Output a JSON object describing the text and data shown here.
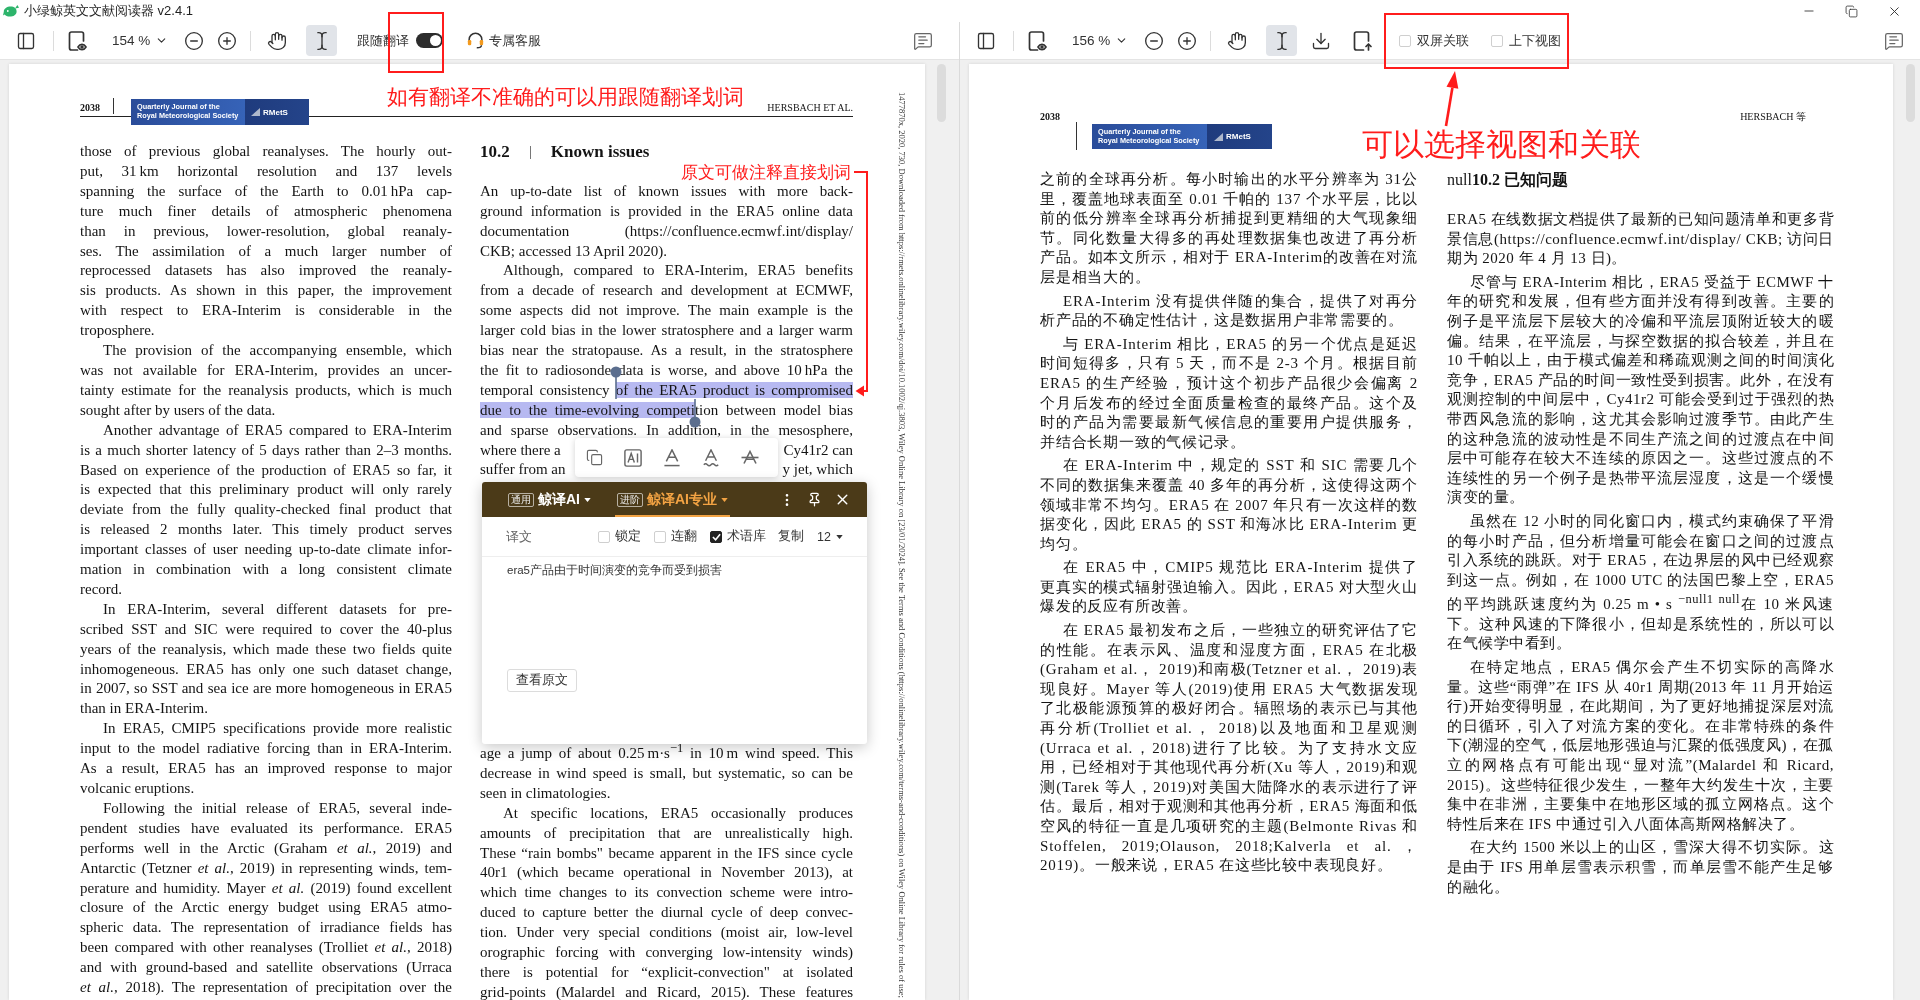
{
  "window": {
    "title": "小绿鲸英文文献阅读器 v2.4.1"
  },
  "left_pane": {
    "toolbar": {
      "zoom": "154 %",
      "tools": [
        {
          "kind": "hand",
          "selected": false
        },
        {
          "kind": "text",
          "selected": true
        }
      ],
      "follow_translation": {
        "label": "跟随翻译",
        "on": true
      },
      "support": "专属客服"
    },
    "page": {
      "page_number": "2038",
      "journal": "Quarterly Journal of the\nRoyal Meteorological Society",
      "publisher": "RMetS",
      "running_head": "HERSBACH ET AL.",
      "column_1": {
        "paragraphs": [
          {
            "text": "those of previous global reanalyses. The hourly out-\nput, 31 km horizontal resolution and 137 levels\nspanning the surface of the Earth to 0.01 hPa cap-\nture much finer details of atmospheric phenomena\nthan in previous, lower-resolution, global reanaly-\nses. The assimilation of a much larger number of\nreprocessed datasets has also improved the reanaly-\nsis products. As shown in this paper, the improvement\nwith respect to ERA-Interim is considerable in the\ntroposphere."
          },
          {
            "text": "The provision of the accompanying ensemble, which\nwas not available for ERA-Interim, provides an uncer-\ntainty estimate for the reanalysis products, which is much\nsought after by users of the data."
          },
          {
            "text": "Another advantage of ERA5 compared to ERA-Interim\nis a much shorter latency of 5 days rather than 2–3 months.\nBased on experience of the production of ERA5 so far, it\nis expected that this preliminary product will only rarely\ndeviate from the fully quality-checked final product that\nis released 2 months later. This timely product serves\nimportant classes of user needing up-to-date climate infor-\nmation in combination with a long consistent climate\nrecord."
          },
          {
            "text": "In ERA-Interim, several different datasets for pre-\nscribed SST and SIC were required to cover the 40-plus\nyears of the reanalysis, which made these two fields quite\ninhomogeneous. ERA5 has only one such dataset change,\nin 2007, so SST and sea ice are more homogeneous in ERA5\nthan in ERA-Interim."
          },
          {
            "text": "In ERA5, CMIP5 specifications provide more realistic\ninput to the model radiative forcing than in ERA-Interim.\nAs a result, ERA5 has an improved response to major\nvolcanic eruptions."
          },
          {
            "text": "Following the initial release of ERA5, several inde-\npendent studies have evaluated its performance. ERA5\nperforms well in the Arctic (Graham *et al.*, 2019) and\nAntarctic (Tetzner *et al.*, 2019) in representing winds, tem-\nperature and humidity. Mayer *et al.* (2019) found excellent\nclosure of the Arctic energy budget using ERA5 atmo-\nspheric data. The representation of irradiance fields has\nbeen compared with other reanalyses (Trolliet *et al.*, 2018)\nand with ground-based and satellite observations (Urraca\n*et al.*, 2018). The representation of precipitation over the"
          }
        ]
      },
      "column_2": {
        "section_number": "10.2",
        "section_title": "Known issues",
        "paragraphs": [
          {
            "text": "An up-to-date list of known issues with more back-\nground information is provided in the ERA5 online data\ndocumentation (https://confluence.ecmwf.int/display/\nCKB; accessed 13 April 2020)."
          },
          {
            "segments": [
              {
                "text": "Although, compared to ERA-Interim, ERA5 benefits\nfrom a decade of research and development at ECMWF,\nsome aspects did not improve. The main example is the\nlarger cold bias in the lower stratosphere and a larger warm\nbias near the stratopause. As a result, in the stratosphere\nthe fit to radiosonde data is worse, and above 10 hPa the",
                "selected": false
              },
              {
                "text": "temporal consistency ",
                "selected": false
              },
              {
                "text": "of the ERA5 product is compromised",
                "selected": true
              },
              {
                "text": "due to the time-evolving competi",
                "selected": true
              },
              {
                "text": "tion between model bias",
                "selected": false
              },
              {
                "text": "and sparse observations. In addition, in the mesosphere,",
                "selected": false
              }
            ]
          }
        ],
        "partly_hidden_lines": [
          {
            "start": "where there a",
            "end": "Cy41r2 can"
          },
          {
            "start": "suffer from an",
            "end": "y jet, which"
          }
        ],
        "paragraphs_below_popup": [
          {
            "text": "age a jump of about 0.25 m·s$^{−1}$ in 10 m wind speed. This\ndecrease in wind speed is small, but systematic, so can be\nseen in climatologies."
          },
          {
            "text": "At specific locations, ERA5 occasionally produces\namounts of precipitation that are unrealistically high.\nThese “rain bombs\" became apparent in the IFS since cycle\n40r1 (which became operational in November 2013), at\nwhich time changes to its convection scheme were intro-\nduced to capture better the diurnal cycle of deep convec-\ntion. Under very special conditions (moist air, low-level\norographic forcing with converging low-intensity winds)\nthere is potential for “explicit-convection\" at isolated\ngrid-points (Malardel and Ricard, 2015). These features"
          }
        ]
      },
      "margin_note": "1477870x, 2020, 730, Downloaded from https://rmets.onlinelibrary.wiley.com/doi/10.1002/qj.3803, Wiley Online Library on [23/01/2024]. See the Terms and Conditions (https://onlinelibrary.wiley.com/terms-and-conditions) on Wiley Online Library for rules of use;"
    }
  },
  "right_pane": {
    "toolbar": {
      "zoom": "156 %",
      "tools": [
        {
          "kind": "hand",
          "selected": false
        },
        {
          "kind": "text",
          "selected": true
        }
      ],
      "view_options": [
        {
          "label": "双屏关联",
          "checked": false
        },
        {
          "label": "上下视图",
          "checked": false
        }
      ]
    },
    "page": {
      "page_number": "2038",
      "journal": "Quarterly Journal of the\nRoyal Meteorological Society",
      "publisher": "RMetS",
      "running_head": "HERSBACH 等",
      "column_1": {
        "paragraphs": [
          {
            "text": "之前的全球再分析。每小时输出的水平分辨率为 31公里，覆盖地球表面至 0.01 千帕的 137 个水平层，比以前的低分辨率全球再分析捕捉到更精细的大气现象细节。同化数量大得多的再处理数据集也改进了再分析产品。如本文所示，相对于 ERA-Interim的改善在对流层是相当大的。"
          },
          {
            "text": "ERA-Interim 没有提供伴随的集合，提供了对再分析产品的不确定性估计，这是数据用户非常需要的。"
          },
          {
            "text": "与 ERA-Interim 相比，ERA5 的另一个优点是延迟时间短得多，只有 5 天，而不是 2-3 个月。根据目前ERA5 的生产经验，预计这个初步产品很少会偏离 2 个月后发布的经过全面质量检查的最终产品。这个及时的产品为需要最新气候信息的重要用户提供服务，并结合长期一致的气候记录。"
          },
          {
            "text": "在 ERA-Interim 中，规定的 SST 和 SIC 需要几个不同的数据集来覆盖 40 多年的再分析，这使得这两个领域非常不均匀。ERA5 在 2007 年只有一次这样的数据变化，因此 ERA5 的 SST 和海冰比 ERA-Interim 更均匀。"
          },
          {
            "text": "在 ERA5 中，CMIP5 规范比 ERA-Interim 提供了更真实的模式辐射强迫输入。因此，ERA5 对大型火山爆发的反应有所改善。"
          },
          {
            "text": "在 ERA5 最初发布之后，一些独立的研究评估了它的性能。在表示风、温度和湿度方面，ERA5 在北极(Graham et al.， 2019)和南极(Tetzner et al.， 2019)表现良好。Mayer 等人(2019)使用 ERA5 大气数据发现了北极能源预算的极好闭合。辐照场的表示已与其他再分析(Trolliet et al.， 2018)以及地面和卫星观测(Urraca et al.，2018)进行了比较。为了支持水文应用，已经相对于其他现代再分析(Xu 等人，2019)和观测(Tarek 等人，2019)对美国大陆降水的表示进行了评估。最后，相对于观测和其他再分析，ERA5 海面和低空风的特征一直是几项研究的主题(Belmonte Rivas 和 Stoffelen, 2019;Olauson, 2018;Kalverla et al.， 2019)。一般来说，ERA5 在这些比较中表现良好。"
          }
        ]
      },
      "column_2": {
        "heading": "null**10.2 已知问题**",
        "paragraphs": [
          {
            "text": "ERA5 在线数据文档提供了最新的已知问题清单和更多背景信息(https://confluence.ecmwf.int/display/ CKB; 访问日期为 2020 年 4 月 13 日)。"
          },
          {
            "text": "尽管与 ERA-Interim 相比，ERA5 受益于 ECMWF 十年的研究和发展，但有些方面并没有得到改善。主要的例子是平流层下层较大的冷偏和平流层顶附近较大的暖偏。结果，在平流层，与探空数据的拟合较差，并且在10 千帕以上，由于模式偏差和稀疏观测之间的时间演化竞争，ERA5 产品的时间一致性受到损害。此外，在没有观测控制的中间层中，Cy41r2 可能会受到过于强烈的热带西风急流的影响，这尤其会影响过渡季节。由此产生的这种急流的波动性是不同生产流之间的过渡点在中间层中可能存在较大不连续的原因之一。这些过渡点的不连续性的另一个例子是热带平流层湿度，这是一个缓慢演变的量。"
          },
          {
            "text": "虽然在 12 小时的同化窗口内，模式约束确保了平滑的每小时产品，但分析增量可能会在窗口之间的过渡点引入系统的跳跃。对于 ERA5，在边界层的风中已经观察到这一点。例如，在 1000 UTC 的法国巴黎上空，ERA5的平均跳跃速度约为 0.25 m • s $^{−null1 null}$在 10 米风速下。这种风速的下降很小，但却是系统性的，所以可以在气候学中看到。"
          },
          {
            "text": "在特定地点，ERA5 偶尔会产生不切实际的高降水量。这些“雨弹”在 IFS 从 40r1 周期(2013 年 11 月开始运行)开始变得明显，在此期间，为了更好地捕捉深层对流的日循环，引入了对流方案的变化。在非常特殊的条件下(潮湿的空气，低层地形强迫与汇聚的低强度风)，在孤立的网格点有可能出现“显对流”(Malardel 和 Ricard, 2015)。这些特征很少发生，一整年大约发生十次，主要集中在非洲，主要集中在地形区域的孤立网格点。这个特性后来在 IFS 中通过引入八面体高斯网格解决了。"
          },
          {
            "text": "在大约 1500 米以上的山区，雪深大得不切实际。这是由于 IFS 用单层雪表示积雪，而单层雪不能产生足够的融化。"
          }
        ]
      }
    }
  },
  "translate_popup": {
    "engines": [
      {
        "tag": "通用",
        "name": "鲸译AI",
        "selected": false
      },
      {
        "tag": "进阶",
        "name": "鲸译AI专业",
        "selected": true
      }
    ],
    "heading": "译文",
    "options": [
      {
        "label": "锁定",
        "checked": false
      },
      {
        "label": "连翻",
        "checked": false
      },
      {
        "label": "术语库",
        "checked": true
      }
    ],
    "copy": "复制",
    "font_size": "12",
    "result": "era5产品由于时间演变的竞争而受到损害",
    "view_original": "查看原文"
  },
  "annotations": [
    {
      "text": "如有翻译不准确的可以用跟随翻译划词"
    },
    {
      "text": "原文可做注释直接划词"
    },
    {
      "text": "可以选择视图和关联"
    }
  ]
}
